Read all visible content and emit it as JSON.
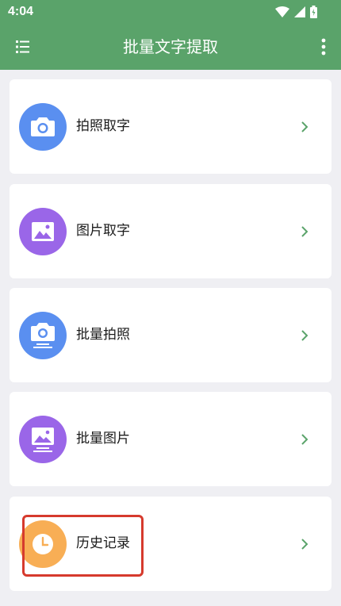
{
  "status_bar": {
    "time": "4:04",
    "icons": [
      "wifi-icon",
      "signal-icon",
      "battery-icon"
    ]
  },
  "app_bar": {
    "title": "批量文字提取",
    "menu_icon": "list-icon",
    "more_icon": "more-vert-icon",
    "color": "#5aa36a"
  },
  "menu": {
    "items": [
      {
        "label": "拍照取字",
        "icon": "camera-icon",
        "color": "#5a8ff0"
      },
      {
        "label": "图片取字",
        "icon": "image-icon",
        "color": "#9a66e8"
      },
      {
        "label": "批量拍照",
        "icon": "batch-camera-icon",
        "color": "#5a8ff0"
      },
      {
        "label": "批量图片",
        "icon": "batch-image-icon",
        "color": "#9a66e8"
      },
      {
        "label": "历史记录",
        "icon": "clock-icon",
        "color": "#f8ae55"
      }
    ]
  },
  "highlight_color": "#d63a2d"
}
